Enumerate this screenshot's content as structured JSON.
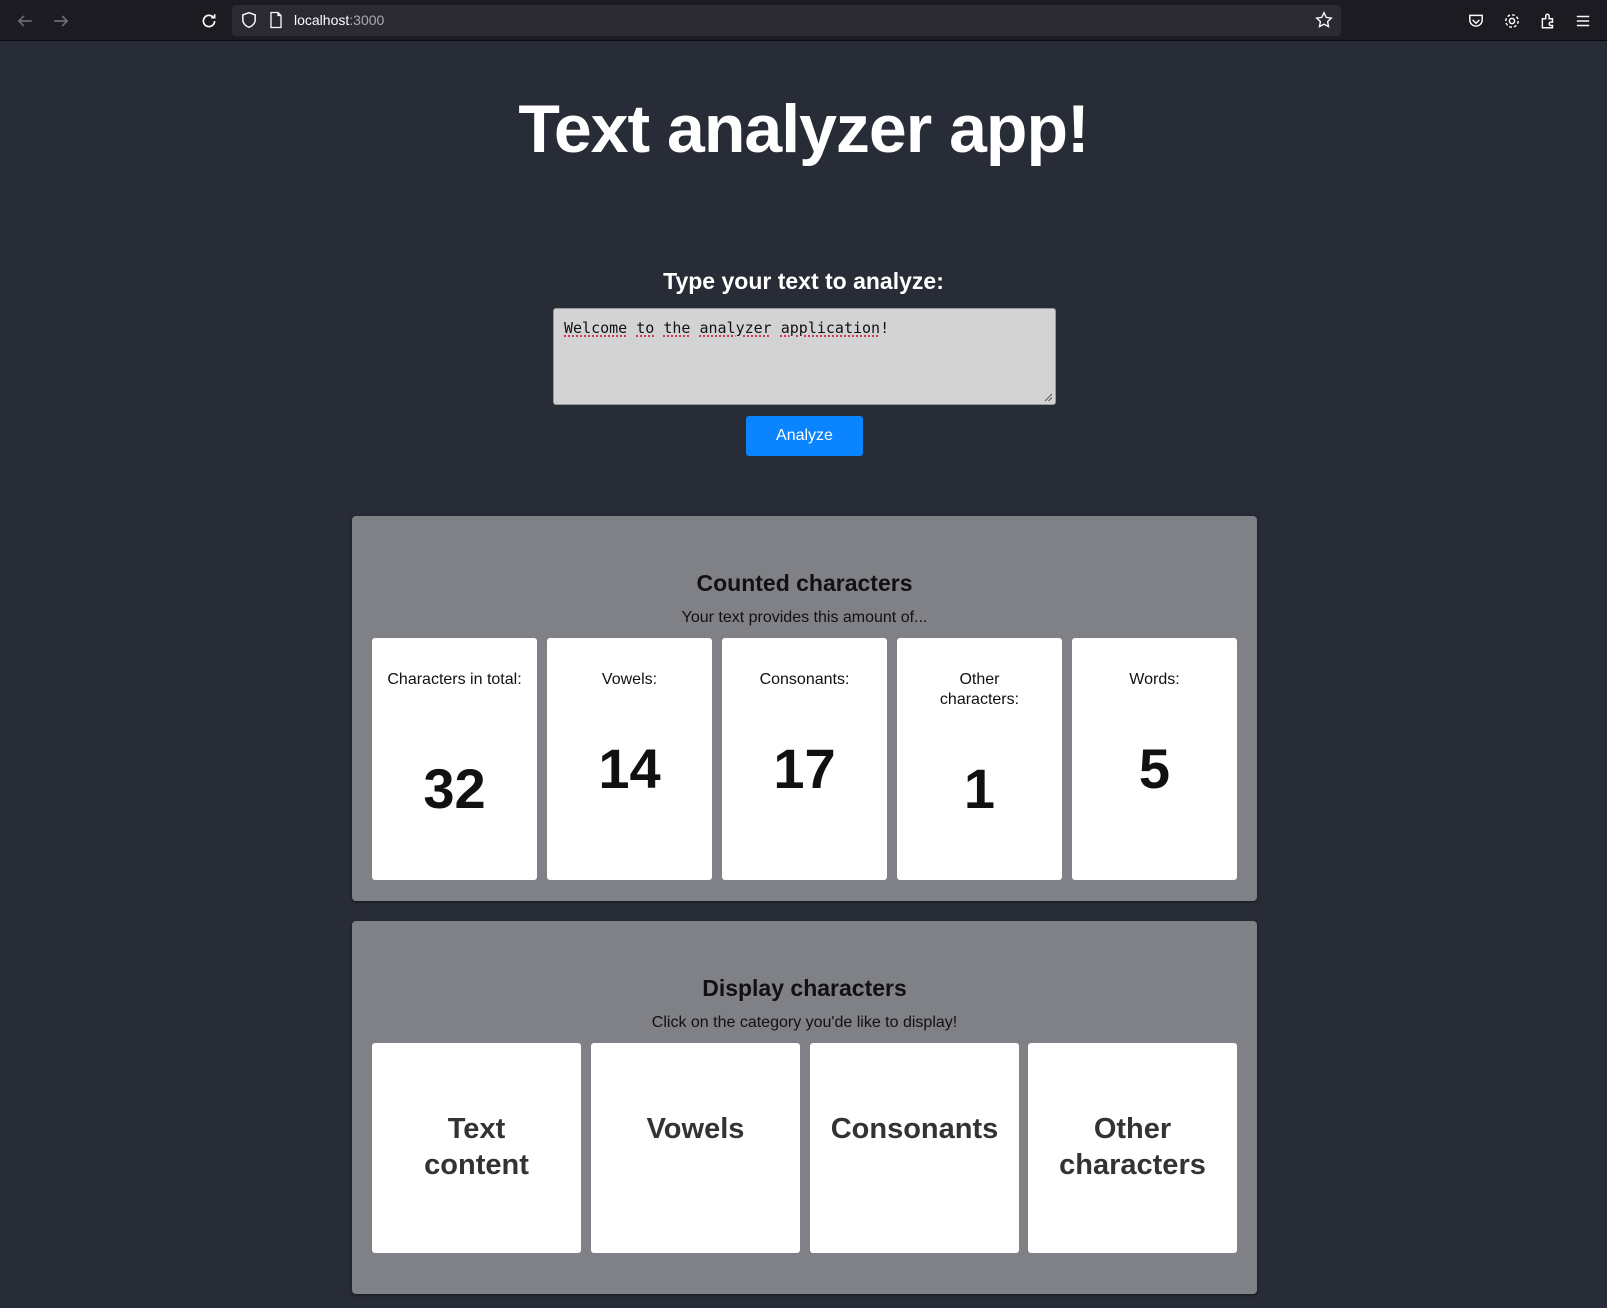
{
  "browser": {
    "url_host": "localhost",
    "url_port": ":3000"
  },
  "page": {
    "title": "Text analyzer app!",
    "prompt_label": "Type your text to analyze:",
    "input_value_words": [
      "Welcome",
      "to",
      "the",
      "analyzer",
      "application"
    ],
    "input_value_tail": "!",
    "analyze_label": "Analyze"
  },
  "counted": {
    "title": "Counted characters",
    "subtitle": "Your text provides this amount of...",
    "stats": [
      {
        "label": "Characters in total:",
        "value": "32"
      },
      {
        "label": "Vowels:",
        "value": "14"
      },
      {
        "label": "Consonants:",
        "value": "17"
      },
      {
        "label": "Other characters:",
        "value": "1"
      },
      {
        "label": "Words:",
        "value": "5"
      }
    ]
  },
  "display": {
    "title": "Display characters",
    "subtitle": "Click on the category you'de like to display!",
    "categories": [
      {
        "label": "Text content"
      },
      {
        "label": "Vowels"
      },
      {
        "label": "Consonants"
      },
      {
        "label": "Other characters"
      }
    ]
  },
  "icons": [
    "back-arrow-icon",
    "forward-arrow-icon",
    "reload-icon",
    "shield-icon",
    "page-icon",
    "star-icon",
    "pocket-icon",
    "gear-icon",
    "extensions-icon",
    "menu-icon"
  ],
  "colors": {
    "page_bg": "#282c36",
    "panel_bg": "#7f8186",
    "accent": "#0a84ff"
  }
}
